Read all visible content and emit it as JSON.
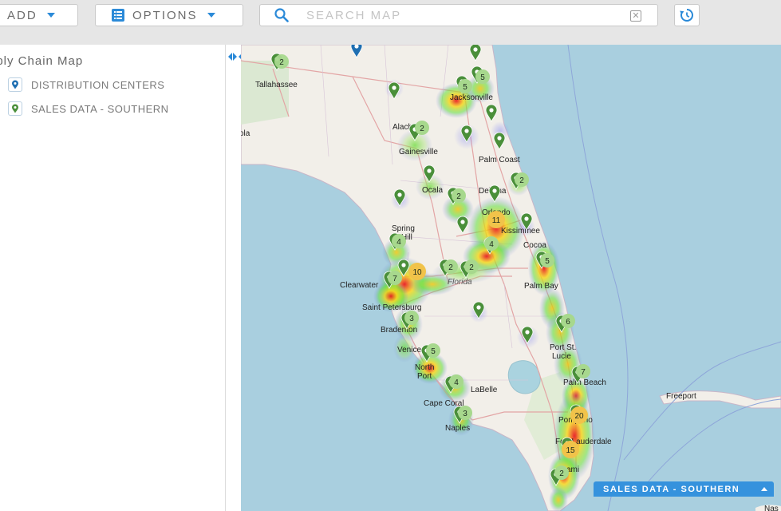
{
  "toolbar": {
    "add_label": "ADD",
    "options_label": "OPTIONS",
    "search_placeholder": "SEARCH MAP",
    "clear_symbol": "✕",
    "accent_color": "#2b8ad8"
  },
  "sidebar": {
    "title": "pply Chain Map",
    "layers": [
      {
        "label": "DISTRIBUTION CENTERS",
        "icon": "pin-icon",
        "color": "#1f6fb2"
      },
      {
        "label": "SALES DATA - SOUTHERN",
        "icon": "pin-icon",
        "color": "#4a8f3a"
      }
    ]
  },
  "map": {
    "places": [
      "Tallahassee",
      "Jacksonville",
      "Alach",
      "Gainesville",
      "Palm Coast",
      "ola",
      "Ocala",
      "Deltona",
      "Orlando",
      "Spring",
      "Hill",
      "Clearwater",
      "Saint Petersburg",
      "Florida",
      "Kissimmee",
      "Cocoa",
      "Palm Bay",
      "Bradenton",
      "Venice",
      "North",
      "Port",
      "Cape Coral",
      "LaBelle",
      "Naples",
      "Port St.",
      "Lucie",
      "Palm Beach",
      "Freeport",
      "Fort Lauderdale",
      "Pompano",
      "ami",
      "Nas"
    ],
    "clusters": [
      "2",
      "5",
      "5",
      "2",
      "2",
      "2",
      "11",
      "4",
      "4",
      "10",
      "7",
      "2",
      "2",
      "5",
      "3",
      "6",
      "5",
      "7",
      "4",
      "3",
      "20",
      "15",
      "2"
    ],
    "pin_colors": {
      "sales": "#4a8f3a",
      "distribution": "#1f6fb2"
    }
  },
  "legend": {
    "label": "SALES DATA - SOUTHERN"
  }
}
